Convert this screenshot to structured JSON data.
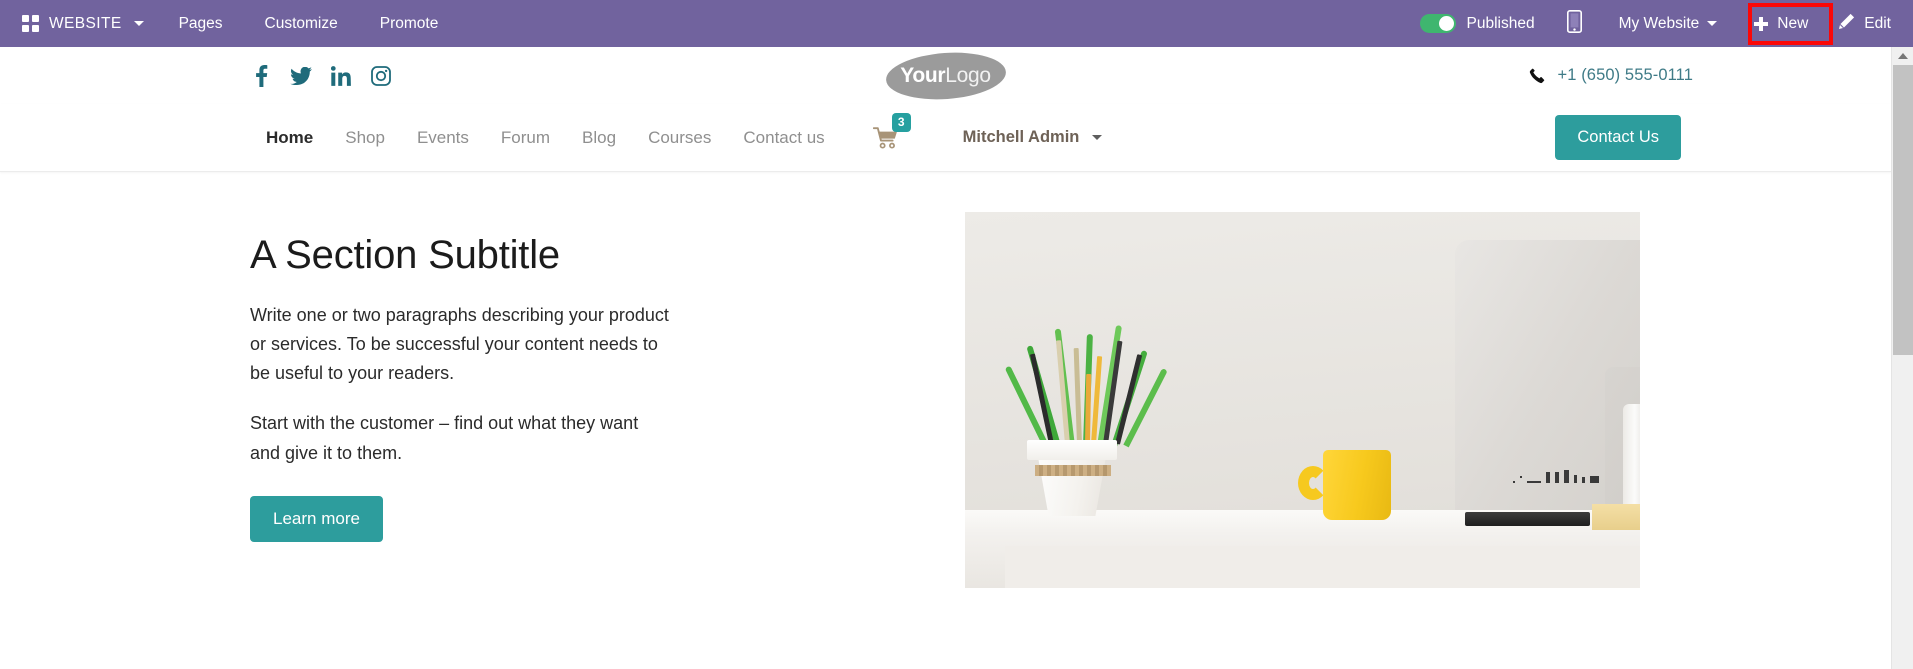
{
  "admin_bar": {
    "apps_label": "WEBSITE",
    "apps_icon": "grid-icon",
    "menus": [
      {
        "label": "Pages"
      },
      {
        "label": "Customize"
      },
      {
        "label": "Promote"
      }
    ],
    "publish_toggle": {
      "label": "Published",
      "state": "on",
      "color": "#3fb66f"
    },
    "mobile_preview_icon": "mobile-phone-icon",
    "website_selector": {
      "label": "My Website"
    },
    "new_button": {
      "label": "New",
      "icon": "plus-icon",
      "highlighted": true,
      "highlight_color": "#fb0707"
    },
    "edit_button": {
      "label": "Edit",
      "icon": "pencil-icon"
    },
    "background_color": "#71639e"
  },
  "site_header": {
    "socials": [
      {
        "name": "facebook-icon"
      },
      {
        "name": "twitter-icon"
      },
      {
        "name": "linkedin-icon"
      },
      {
        "name": "instagram-icon"
      }
    ],
    "logo": {
      "bold_part": "Your",
      "light_part": "Logo"
    },
    "phone": {
      "icon": "phone-icon",
      "number": "+1 (650) 555-0111",
      "color": "#3f7b87"
    }
  },
  "site_nav": {
    "links": [
      {
        "label": "Home",
        "active": true
      },
      {
        "label": "Shop",
        "active": false
      },
      {
        "label": "Events",
        "active": false
      },
      {
        "label": "Forum",
        "active": false
      },
      {
        "label": "Blog",
        "active": false
      },
      {
        "label": "Courses",
        "active": false
      },
      {
        "label": "Contact us",
        "active": false
      }
    ],
    "cart": {
      "icon": "shopping-cart-icon",
      "badge_count": "3",
      "badge_color": "#26a0a0"
    },
    "user": {
      "name": "Mitchell Admin"
    },
    "cta_button": {
      "label": "Contact Us",
      "color": "#2d9d9d"
    }
  },
  "hero": {
    "title": "A Section Subtitle",
    "paragraph_1": "Write one or two paragraphs describing your product or services. To be successful your content needs to be useful to your readers.",
    "paragraph_2": "Start with the customer – find out what they want and give it to them.",
    "cta_button": {
      "label": "Learn more",
      "color": "#2d9d9d"
    },
    "image_alt": "Desk with potted plant, yellow mug and computer monitor"
  },
  "scrollbar": {
    "position": "right",
    "thumb_visible": true
  }
}
